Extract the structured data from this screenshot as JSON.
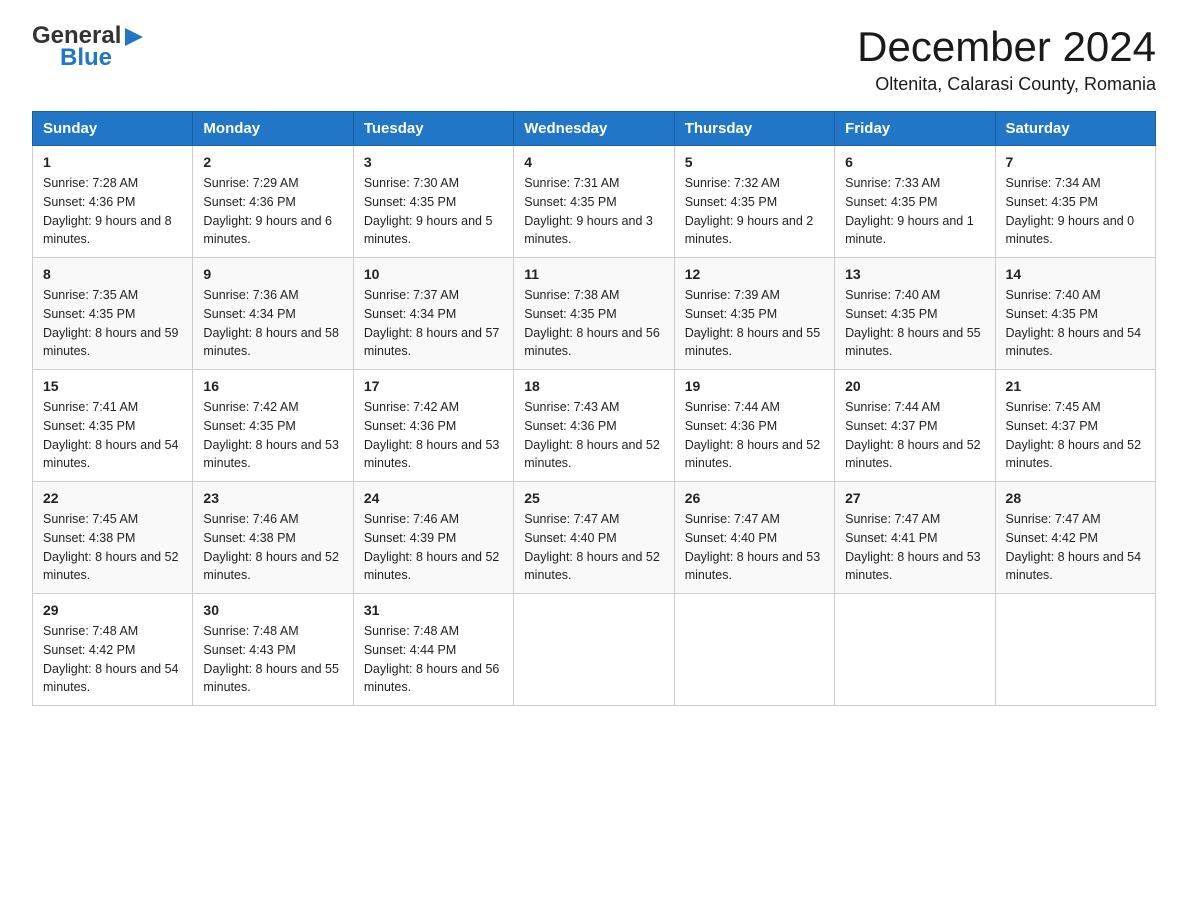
{
  "logo": {
    "general": "General",
    "blue": "Blue",
    "arrow": "▶"
  },
  "header": {
    "month_title": "December 2024",
    "location": "Oltenita, Calarasi County, Romania"
  },
  "days_of_week": [
    "Sunday",
    "Monday",
    "Tuesday",
    "Wednesday",
    "Thursday",
    "Friday",
    "Saturday"
  ],
  "weeks": [
    {
      "days": [
        {
          "num": "1",
          "sunrise": "7:28 AM",
          "sunset": "4:36 PM",
          "daylight": "9 hours and 8 minutes."
        },
        {
          "num": "2",
          "sunrise": "7:29 AM",
          "sunset": "4:36 PM",
          "daylight": "9 hours and 6 minutes."
        },
        {
          "num": "3",
          "sunrise": "7:30 AM",
          "sunset": "4:35 PM",
          "daylight": "9 hours and 5 minutes."
        },
        {
          "num": "4",
          "sunrise": "7:31 AM",
          "sunset": "4:35 PM",
          "daylight": "9 hours and 3 minutes."
        },
        {
          "num": "5",
          "sunrise": "7:32 AM",
          "sunset": "4:35 PM",
          "daylight": "9 hours and 2 minutes."
        },
        {
          "num": "6",
          "sunrise": "7:33 AM",
          "sunset": "4:35 PM",
          "daylight": "9 hours and 1 minute."
        },
        {
          "num": "7",
          "sunrise": "7:34 AM",
          "sunset": "4:35 PM",
          "daylight": "9 hours and 0 minutes."
        }
      ]
    },
    {
      "days": [
        {
          "num": "8",
          "sunrise": "7:35 AM",
          "sunset": "4:35 PM",
          "daylight": "8 hours and 59 minutes."
        },
        {
          "num": "9",
          "sunrise": "7:36 AM",
          "sunset": "4:34 PM",
          "daylight": "8 hours and 58 minutes."
        },
        {
          "num": "10",
          "sunrise": "7:37 AM",
          "sunset": "4:34 PM",
          "daylight": "8 hours and 57 minutes."
        },
        {
          "num": "11",
          "sunrise": "7:38 AM",
          "sunset": "4:35 PM",
          "daylight": "8 hours and 56 minutes."
        },
        {
          "num": "12",
          "sunrise": "7:39 AM",
          "sunset": "4:35 PM",
          "daylight": "8 hours and 55 minutes."
        },
        {
          "num": "13",
          "sunrise": "7:40 AM",
          "sunset": "4:35 PM",
          "daylight": "8 hours and 55 minutes."
        },
        {
          "num": "14",
          "sunrise": "7:40 AM",
          "sunset": "4:35 PM",
          "daylight": "8 hours and 54 minutes."
        }
      ]
    },
    {
      "days": [
        {
          "num": "15",
          "sunrise": "7:41 AM",
          "sunset": "4:35 PM",
          "daylight": "8 hours and 54 minutes."
        },
        {
          "num": "16",
          "sunrise": "7:42 AM",
          "sunset": "4:35 PM",
          "daylight": "8 hours and 53 minutes."
        },
        {
          "num": "17",
          "sunrise": "7:42 AM",
          "sunset": "4:36 PM",
          "daylight": "8 hours and 53 minutes."
        },
        {
          "num": "18",
          "sunrise": "7:43 AM",
          "sunset": "4:36 PM",
          "daylight": "8 hours and 52 minutes."
        },
        {
          "num": "19",
          "sunrise": "7:44 AM",
          "sunset": "4:36 PM",
          "daylight": "8 hours and 52 minutes."
        },
        {
          "num": "20",
          "sunrise": "7:44 AM",
          "sunset": "4:37 PM",
          "daylight": "8 hours and 52 minutes."
        },
        {
          "num": "21",
          "sunrise": "7:45 AM",
          "sunset": "4:37 PM",
          "daylight": "8 hours and 52 minutes."
        }
      ]
    },
    {
      "days": [
        {
          "num": "22",
          "sunrise": "7:45 AM",
          "sunset": "4:38 PM",
          "daylight": "8 hours and 52 minutes."
        },
        {
          "num": "23",
          "sunrise": "7:46 AM",
          "sunset": "4:38 PM",
          "daylight": "8 hours and 52 minutes."
        },
        {
          "num": "24",
          "sunrise": "7:46 AM",
          "sunset": "4:39 PM",
          "daylight": "8 hours and 52 minutes."
        },
        {
          "num": "25",
          "sunrise": "7:47 AM",
          "sunset": "4:40 PM",
          "daylight": "8 hours and 52 minutes."
        },
        {
          "num": "26",
          "sunrise": "7:47 AM",
          "sunset": "4:40 PM",
          "daylight": "8 hours and 53 minutes."
        },
        {
          "num": "27",
          "sunrise": "7:47 AM",
          "sunset": "4:41 PM",
          "daylight": "8 hours and 53 minutes."
        },
        {
          "num": "28",
          "sunrise": "7:47 AM",
          "sunset": "4:42 PM",
          "daylight": "8 hours and 54 minutes."
        }
      ]
    },
    {
      "days": [
        {
          "num": "29",
          "sunrise": "7:48 AM",
          "sunset": "4:42 PM",
          "daylight": "8 hours and 54 minutes."
        },
        {
          "num": "30",
          "sunrise": "7:48 AM",
          "sunset": "4:43 PM",
          "daylight": "8 hours and 55 minutes."
        },
        {
          "num": "31",
          "sunrise": "7:48 AM",
          "sunset": "4:44 PM",
          "daylight": "8 hours and 56 minutes."
        },
        null,
        null,
        null,
        null
      ]
    }
  ]
}
